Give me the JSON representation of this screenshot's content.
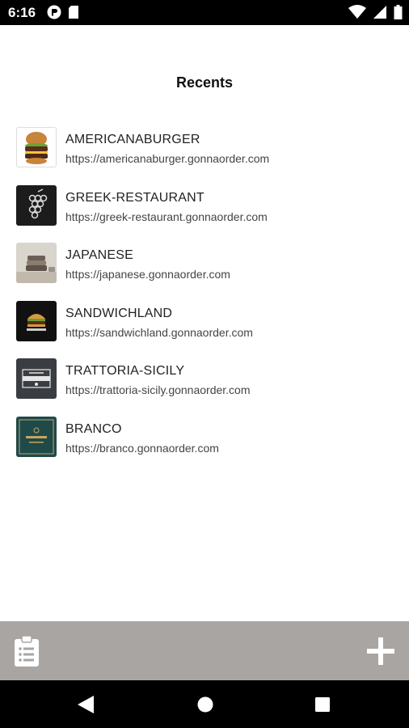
{
  "status_bar": {
    "time": "6:16",
    "left_icons": [
      "app-notification-icon",
      "sd-card-icon"
    ],
    "right_icons": [
      "wifi-icon",
      "signal-icon",
      "battery-icon"
    ]
  },
  "header": {
    "title": "Recents"
  },
  "recents": [
    {
      "name": "AMERICANABURGER",
      "url": "https://americanaburger.gonnaorder.com",
      "icon": "burger-thumbnail"
    },
    {
      "name": "GREEK-RESTAURANT",
      "url": "https://greek-restaurant.gonnaorder.com",
      "icon": "grapes-thumbnail"
    },
    {
      "name": "JAPANESE",
      "url": "https://japanese.gonnaorder.com",
      "icon": "bowls-thumbnail"
    },
    {
      "name": "SANDWICHLAND",
      "url": "https://sandwichland.gonnaorder.com",
      "icon": "sandwich-thumbnail"
    },
    {
      "name": "TRATTORIA-SICILY",
      "url": "https://trattoria-sicily.gonnaorder.com",
      "icon": "trattoria-logo-thumbnail"
    },
    {
      "name": "BRANCO",
      "url": "https://branco.gonnaorder.com",
      "icon": "branco-logo-thumbnail"
    }
  ],
  "toolbar": {
    "left_icon": "clipboard-list-icon",
    "right_icon": "plus-icon",
    "background": "#a8a5a3"
  },
  "nav_bar": {
    "icons": [
      "back-icon",
      "home-icon",
      "recents-icon"
    ]
  }
}
